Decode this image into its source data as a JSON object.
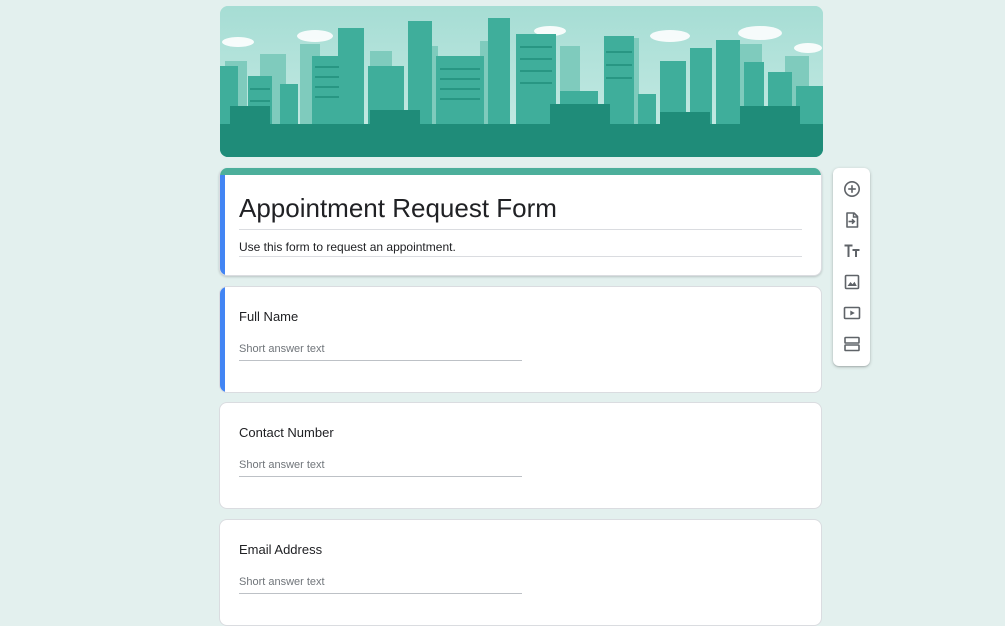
{
  "form": {
    "title": "Appointment Request Form",
    "description": "Use this form to request an appointment."
  },
  "questions": [
    {
      "label": "Full Name",
      "placeholder": "Short answer text"
    },
    {
      "label": "Contact Number",
      "placeholder": "Short answer text"
    },
    {
      "label": "Email Address",
      "placeholder": "Short answer text"
    }
  ],
  "toolbar": {
    "icons": [
      "add-question-icon",
      "import-questions-icon",
      "add-title-text-icon",
      "add-image-icon",
      "add-video-icon",
      "add-section-icon"
    ]
  },
  "colors": {
    "page_background": "#e3f0ee",
    "theme": "#4caf9b",
    "active_accent": "#4285f4",
    "banner_teal": "#2a9d8a"
  }
}
